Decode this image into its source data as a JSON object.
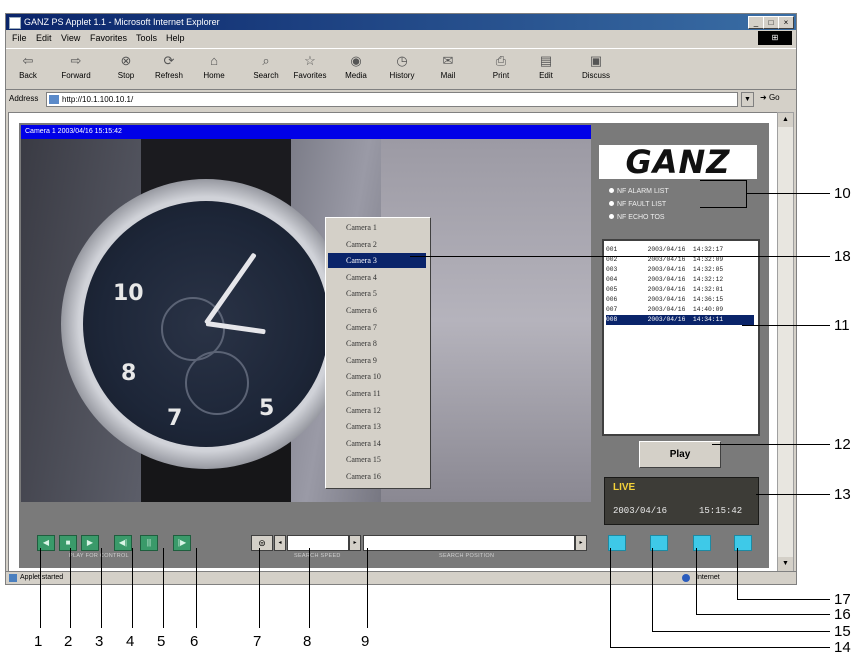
{
  "window": {
    "title": "GANZ PS Applet 1.1 - Microsoft Internet Explorer",
    "win_buttons": [
      "_",
      "□",
      "×"
    ],
    "menu": [
      "File",
      "Edit",
      "View",
      "Favorites",
      "Tools",
      "Help"
    ],
    "toolbar": [
      "Back",
      "Forward",
      "Stop",
      "Refresh",
      "Home",
      "Search",
      "Favorites",
      "Media",
      "History",
      "Mail",
      "Print",
      "Edit",
      "Discuss"
    ],
    "address_label": "Address",
    "address_value": "http://10.1.100.10.1/",
    "go_label": "Go",
    "status_left": "Applet started",
    "status_right": "Internet"
  },
  "viewer": {
    "camera_title": "Camera 1 2003/04/16 15:15:42",
    "camera_menu": [
      "Camera 1",
      "Camera 2",
      "Camera 3",
      "Camera 4",
      "Camera 5",
      "Camera 6",
      "Camera 7",
      "Camera 8",
      "Camera 9",
      "Camera 10",
      "Camera 11",
      "Camera 12",
      "Camera 13",
      "Camera 14",
      "Camera 15",
      "Camera 16"
    ],
    "camera_menu_selected": 2,
    "logo_text": "GANZ",
    "radio_options": [
      "NF ALARM LIST",
      "NF FAULT LIST",
      "NF ECHO TOS"
    ],
    "event_list": [
      "001        2003/04/16  14:32:17",
      "002        2003/04/16  14:32:09",
      "003        2003/04/16  14:32:05",
      "004        2003/04/16  14:32:12",
      "005        2003/04/16  14:32:01",
      "006        2003/04/16  14:36:15",
      "007        2003/04/16  14:40:09",
      "008        2003/04/16  14:34:11"
    ],
    "event_selected": 7,
    "play_label": "Play",
    "status_mode": "LIVE",
    "status_date": "2003/04/16",
    "status_time": "15:15:42",
    "captions": {
      "play_control": "PLAY FOR CONTROL",
      "search_speed": "SEARCH SPEED",
      "search_position": "SEARCH POSITION"
    },
    "control_icons": [
      "prev-icon",
      "stop-icon",
      "play-icon",
      "step-back-icon",
      "pause-icon",
      "step-forward-icon"
    ],
    "control_glyphs": [
      "◀",
      "■",
      "▶",
      "◀|",
      "||",
      "|▶"
    ],
    "camera_button_glyph": "⊜",
    "clock_numerals": [
      "10",
      "8",
      "7",
      "5"
    ]
  },
  "callouts": {
    "bottom": [
      "1",
      "2",
      "3",
      "4",
      "5",
      "6",
      "7",
      "8",
      "9"
    ],
    "right": [
      "10",
      "18",
      "11",
      "12",
      "13",
      "17",
      "16",
      "15",
      "14"
    ]
  },
  "colors": {
    "title_blue": "#0000e8",
    "control_green": "#3a9a6a",
    "view_buttons": "#3ec9e8",
    "live_yellow": "#f4d23a"
  }
}
